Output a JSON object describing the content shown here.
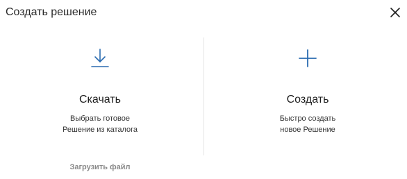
{
  "dialog": {
    "title": "Создать решение",
    "close_icon": "close-icon"
  },
  "options": {
    "download": {
      "icon": "download-icon",
      "heading": "Скачать",
      "desc_line1": "Выбрать готовое",
      "desc_line2": "Решение из каталога"
    },
    "create": {
      "icon": "plus-icon",
      "heading": "Создать",
      "desc_line1": "Быстро создать",
      "desc_line2": "новое Решение"
    }
  },
  "upload_link": "Загрузить файл",
  "colors": {
    "accent": "#2b6cb0",
    "muted": "#8a8a8a",
    "divider": "#e4e4e4"
  }
}
